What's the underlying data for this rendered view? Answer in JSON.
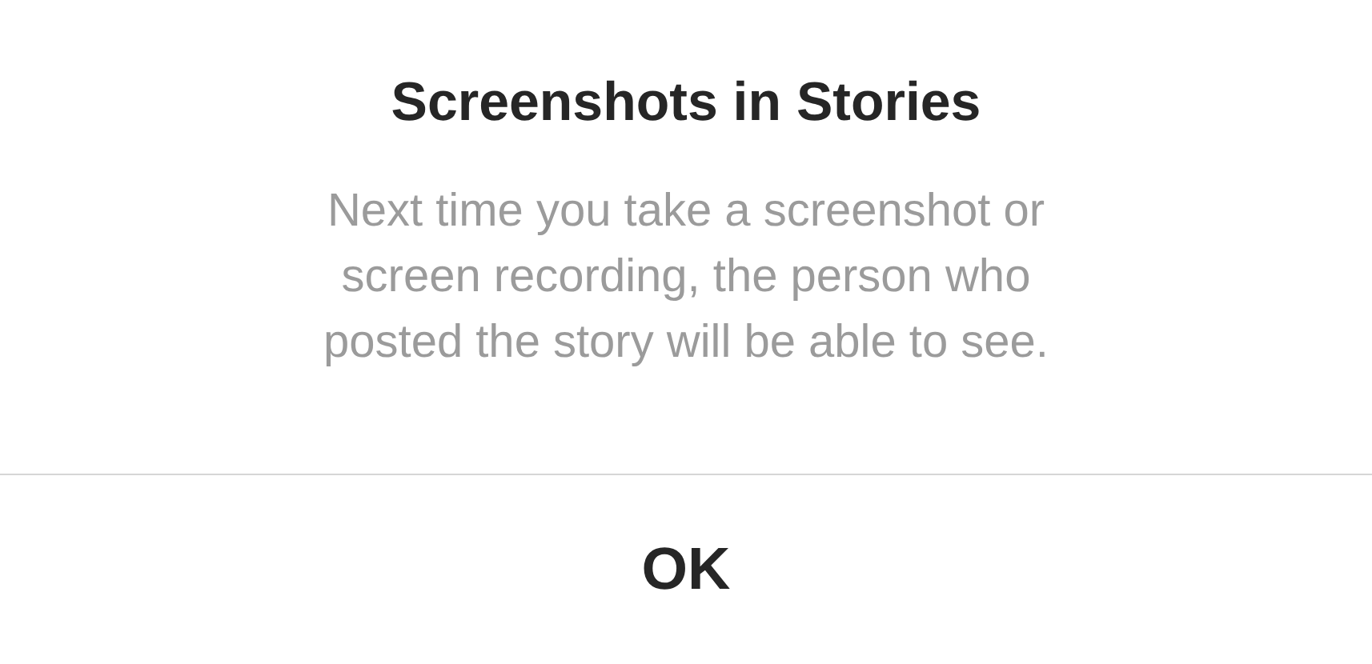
{
  "dialog": {
    "title": "Screenshots in Stories",
    "message_lines": [
      "Next time you take a screenshot or",
      "screen recording, the person who",
      "posted the story will be able to see."
    ],
    "buttons": [
      {
        "label": "OK"
      }
    ]
  }
}
